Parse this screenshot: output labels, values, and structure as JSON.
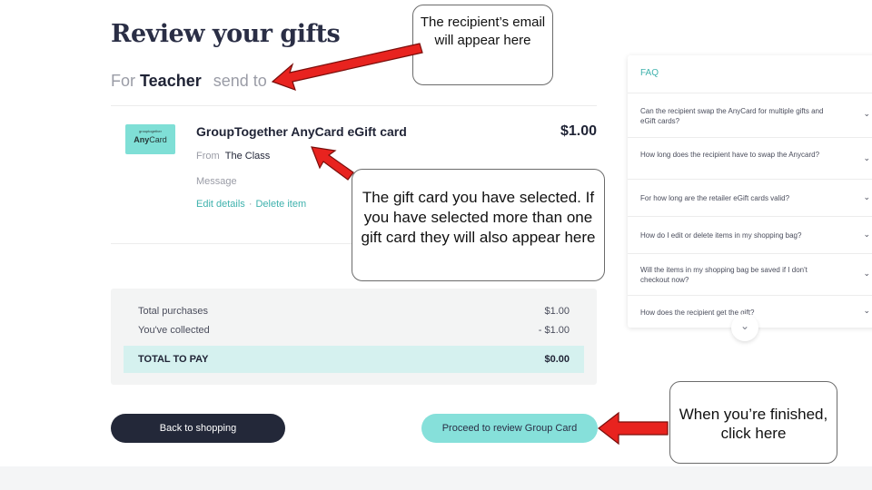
{
  "page": {
    "title": "Review your gifts"
  },
  "recipient": {
    "for_label": "For",
    "name": "Teacher",
    "send_to": "send to"
  },
  "gift": {
    "thumb_tiny": "grouptogether",
    "thumb_brand_bold": "Any",
    "thumb_brand_regular": "Card",
    "name": "GroupTogether AnyCard eGift card",
    "price": "$1.00",
    "from_label": "From",
    "from_name": "The Class",
    "message_label": "Message",
    "edit_label": "Edit details",
    "separator": "·",
    "delete_label": "Delete item"
  },
  "summary": {
    "total_purchases_label": "Total purchases",
    "total_purchases_value": "$1.00",
    "collected_label": "You've collected",
    "collected_value": "- $1.00",
    "total_label": "TOTAL TO PAY",
    "total_value": "$0.00"
  },
  "buttons": {
    "back": "Back to shopping",
    "proceed": "Proceed to review Group Card"
  },
  "faq": {
    "title": "FAQ",
    "items": [
      {
        "q": "Can the recipient swap the AnyCard for multiple gifts and eGift cards?"
      },
      {
        "q": "How long does the recipient have to swap the Anycard?"
      },
      {
        "q": "For how long are the retailer eGift cards valid?"
      },
      {
        "q": "How do I edit or delete items in my shopping bag?"
      },
      {
        "q": "Will the items in my shopping bag be saved if I don't checkout now?"
      },
      {
        "q": "How does the recipient get the gift?"
      }
    ],
    "chevron": "⌄",
    "more": "⌄"
  },
  "callouts": {
    "email": "The recipient’s email will appear here",
    "gift": "The gift card you have selected. If you have selected more than one gift card they will also appear here",
    "finish": "When you’re finished, click here"
  },
  "colors": {
    "accent": "#3fb2ad",
    "proceed_bg": "#86e0da",
    "dark_button": "#232839",
    "arrow": "#e8231f"
  },
  "icons": {
    "faq_chevron": "chevron-down-icon",
    "more": "chevron-down-icon",
    "annotation": "red-arrow-icon"
  }
}
